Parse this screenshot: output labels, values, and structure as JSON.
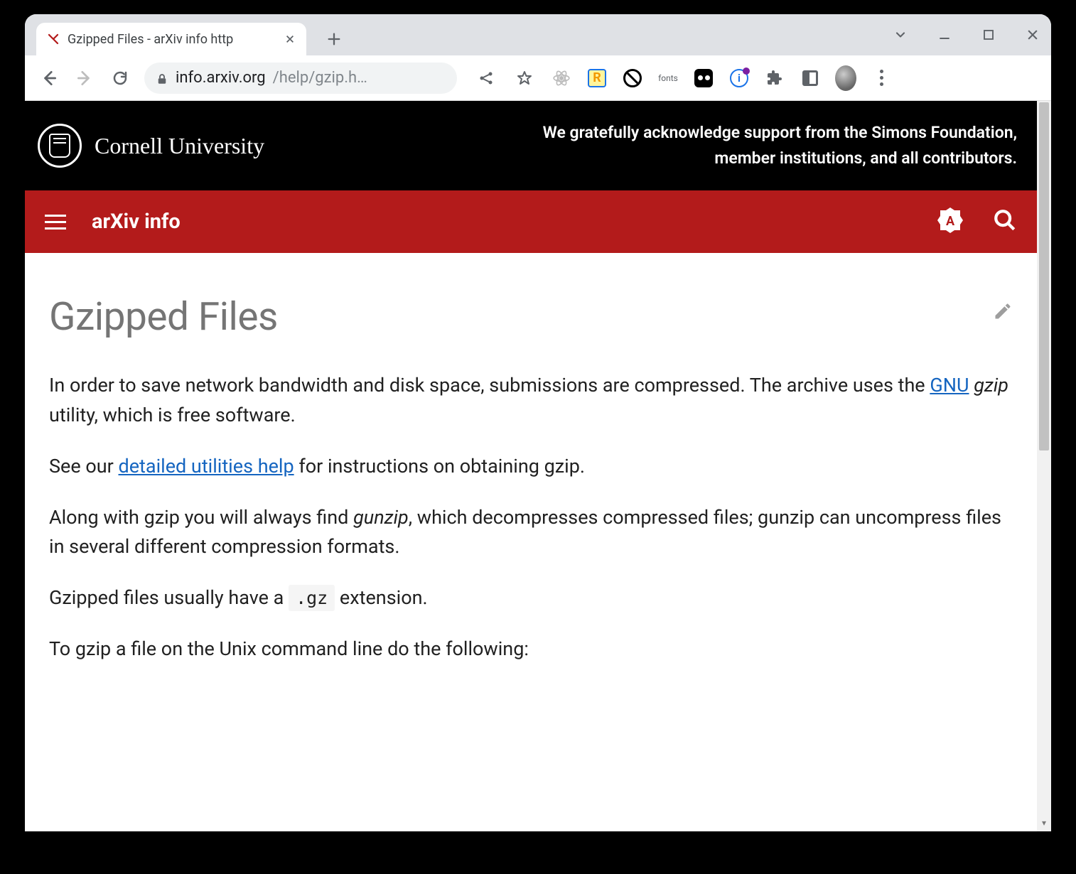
{
  "browser": {
    "tab": {
      "title": "Gzipped Files - arXiv info http"
    },
    "omnibox": {
      "host": "info.arxiv.org",
      "path": "/help/gzip.h…"
    },
    "extensions": {
      "fonts_label": "fonts"
    }
  },
  "page": {
    "cornell": {
      "name": "Cornell University",
      "ack": "We gratefully acknowledge support from the Simons Foundation, member institutions, and all contributors."
    },
    "arxiv_header": {
      "title": "arXiv info",
      "badge_letter": "A"
    },
    "article": {
      "title": "Gzipped Files",
      "p1_a": "In order to save network bandwidth and disk space, submissions are compressed. The archive uses the ",
      "p1_link": "GNU",
      "p1_b": " ",
      "p1_em": "gzip",
      "p1_c": " utility, which is free software.",
      "p2_a": "See our ",
      "p2_link": "detailed utilities help",
      "p2_b": " for instructions on obtaining gzip.",
      "p3_a": "Along with gzip you will always find ",
      "p3_em": "gunzip",
      "p3_b": ", which decompresses compressed files; gunzip can uncompress files in several different compression formats.",
      "p4_a": "Gzipped files usually have a ",
      "p4_code": ".gz",
      "p4_b": " extension.",
      "p5": "To gzip a file on the Unix command line do the following:"
    }
  }
}
